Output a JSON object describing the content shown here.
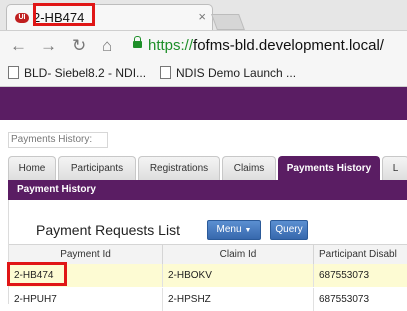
{
  "browser": {
    "tab_title": "2-HB474",
    "url_scheme": "https://",
    "url_host": "fofms-bld.development.local/",
    "bookmarks": [
      {
        "label": "BLD- Siebel8.2 - NDI..."
      },
      {
        "label": "NDIS Demo Launch ..."
      }
    ]
  },
  "app": {
    "breadcrumb": "Payments History:",
    "tabs": [
      "Home",
      "Participants",
      "Registrations",
      "Claims",
      "Payments History",
      "L"
    ],
    "active_tab": "Payments History",
    "sub_tab": "Payment History",
    "list": {
      "title": "Payment Requests List",
      "menu_label": "Menu",
      "query_label": "Query",
      "columns": [
        "Payment Id",
        "Claim Id",
        "Participant Disabl"
      ],
      "rows": [
        {
          "payment_id": "2-HB474",
          "claim_id": "2-HBOKV",
          "participant": "687553073",
          "selected": true
        },
        {
          "payment_id": "2-HPUH7",
          "claim_id": "2-HPSHZ",
          "participant": "687553073",
          "selected": false
        }
      ]
    }
  },
  "colors": {
    "brand_purple": "#5a1d63",
    "highlight_red": "#e01616",
    "selected_row": "#fdfbd3",
    "button_blue": "#3768ad"
  }
}
